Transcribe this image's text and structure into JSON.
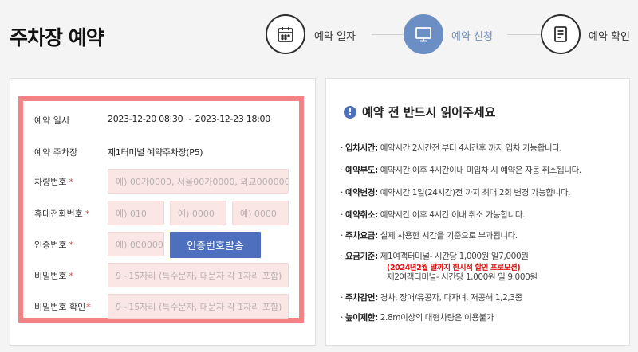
{
  "page_title": "주차장 예약",
  "steps": [
    {
      "label": "예약 일자",
      "icon": "calendar-icon",
      "state": "inactive"
    },
    {
      "label": "예약 신청",
      "icon": "monitor-icon",
      "state": "active"
    },
    {
      "label": "예약 확인",
      "icon": "document-icon",
      "state": "inactive"
    }
  ],
  "colors": {
    "accent": "#4d6fbd",
    "step_active": "#6b8ec4",
    "highlight_border": "#f48282",
    "input_bg": "#fbe6e6",
    "promo": "#dd1111"
  },
  "form": {
    "reservation_datetime": {
      "label": "예약 일시",
      "value": "2023-12-20 08:30 ~ 2023-12-23 18:00"
    },
    "parking_lot": {
      "label": "예약 주차장",
      "value": "제1터미널 예약주차장(P5)"
    },
    "car_number": {
      "label": "차량번호",
      "required": "*",
      "placeholder": "예) 00가0000, 서울00가0000, 외교000000"
    },
    "phone": {
      "label": "휴대전화번호",
      "required": "*",
      "placeholders": [
        "예) 010",
        "예) 0000",
        "예) 0000"
      ]
    },
    "auth_code": {
      "label": "인증번호",
      "required": "*",
      "placeholder": "예) 000000",
      "button": "인증번호발송"
    },
    "password": {
      "label": "비밀번호",
      "required": "*",
      "placeholder": "9~15자리 (특수문자, 대문자 각 1자리 포함)"
    },
    "password_confirm": {
      "label": "비밀번호 확인",
      "required": "*",
      "placeholder": "9~15자리 (특수문자, 대문자 각 1자리 포함)"
    }
  },
  "notice": {
    "icon": "!",
    "title": "예약 전 반드시 읽어주세요",
    "items": [
      {
        "key": "입차시간",
        "text": "예약시간 2시간전 부터 4시간후 까지 입차 가능합니다."
      },
      {
        "key": "예약부도",
        "text": "예약시간 이후 4시간이내 미입차 시 예약은 자동 취소됩니다."
      },
      {
        "key": "예약변경",
        "text": "예약시간 1일(24시간)전 까지 최대 2회 변경 가능합니다."
      },
      {
        "key": "예약취소",
        "text": "예약시간 이후 4시간 이내 취소 가능합니다."
      },
      {
        "key": "주차요금",
        "text": "실제 사용한 시간을 기준으로 부과됩니다."
      },
      {
        "key": "요금기준",
        "text": "제1여객터미널- 시간당 1,000원 일7,000원",
        "promo": "(2024년2월 말까지 한시적 할인 프로모션)",
        "extra": "제2여객터미널- 시간당 1,000원 일 9,000원"
      },
      {
        "key": "주차감면",
        "text": "경차, 장애/유공자, 다자녀, 저공해 1,2,3종"
      },
      {
        "key": "높이제한",
        "text": "2.8m이상의 대형차량은 이용불가"
      }
    ]
  }
}
